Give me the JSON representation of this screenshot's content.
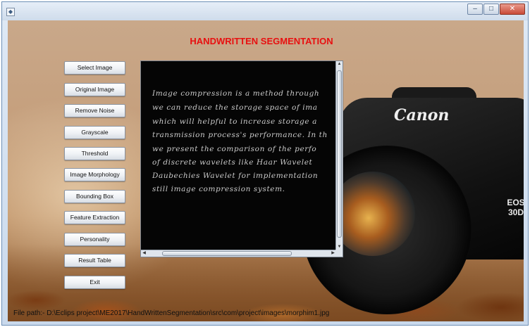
{
  "window": {
    "icons": {
      "app": "java-app-icon",
      "minimize": "minimize-icon",
      "maximize": "maximize-icon",
      "close": "close-icon"
    }
  },
  "app": {
    "title": "HANDWRITTEN SEGMENTATION",
    "title_color": "#e81010"
  },
  "buttons": [
    "Select Image",
    "Original Image",
    "Remove Noise",
    "Grayscale",
    "Threshold",
    "Image Morphology",
    "Bounding Box",
    "Feature Extraction",
    "Personality",
    "Result Table",
    "Exit"
  ],
  "image_panel": {
    "lines": [
      "Image   compression   is  a  method   through",
      "we  can  reduce   the   storage  space  of  ima",
      "which   will  helpful   to  increase  storage  a",
      "transmission  process's  performance.  In  th",
      "we  present   the  comparison   of  the   perfo",
      "of  discrete   wavelets   like  Haar  Wavelet",
      "Daubechies   Wavelet   for  implementation",
      "still  image   compression   system."
    ]
  },
  "background": {
    "camera_brand": "Canon",
    "camera_model": "EOS 30D"
  },
  "status": {
    "filepath": "File path:- D:\\Eclips project\\ME2017\\HandWrittenSegmentation\\src\\com\\project\\images\\morphim1.jpg"
  }
}
